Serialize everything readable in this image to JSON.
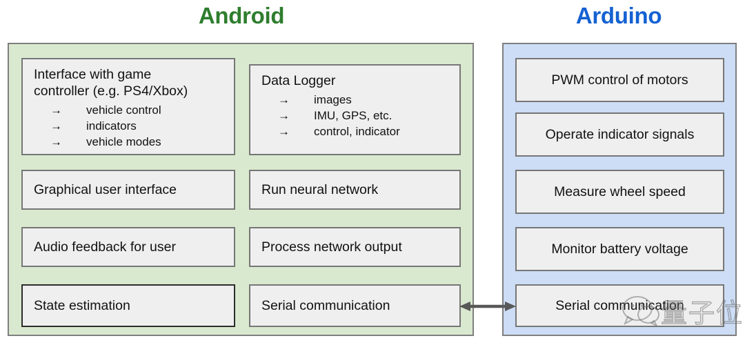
{
  "diagram": {
    "columns": [
      {
        "id": "android",
        "title": "Android",
        "title_color": "#2E7D2E",
        "panel_color": "#D9E9CF"
      },
      {
        "id": "arduino",
        "title": "Arduino",
        "title_color": "#1461D2",
        "panel_color": "#CCDDF5"
      }
    ],
    "android": {
      "column_left": [
        {
          "label": "Interface with game\ncontroller (e.g. PS4/Xbox)",
          "bullets": [
            "vehicle control",
            "indicators",
            "vehicle modes"
          ],
          "bullet_marker": "→"
        },
        {
          "label": "Graphical user interface",
          "bullets": []
        },
        {
          "label": "Audio feedback for user",
          "bullets": []
        },
        {
          "label": "State estimation",
          "bullets": []
        }
      ],
      "column_right": [
        {
          "label": "Data Logger",
          "bullets": [
            "images",
            "IMU, GPS, etc.",
            "control, indicator"
          ],
          "bullet_marker": "→"
        },
        {
          "label": "Run neural network",
          "bullets": []
        },
        {
          "label": "Process network output",
          "bullets": []
        },
        {
          "label": "Serial communication",
          "bullets": []
        }
      ]
    },
    "arduino": {
      "boxes": [
        {
          "label": "PWM control of motors"
        },
        {
          "label": "Operate indicator signals"
        },
        {
          "label": "Measure wheel speed"
        },
        {
          "label": "Monitor battery voltage"
        },
        {
          "label": "Serial communication"
        }
      ]
    },
    "connector": {
      "name": "bidirectional-serial-link",
      "color": "#585858"
    },
    "watermark": {
      "text": "量子位",
      "icon": "wechat-icon"
    }
  }
}
